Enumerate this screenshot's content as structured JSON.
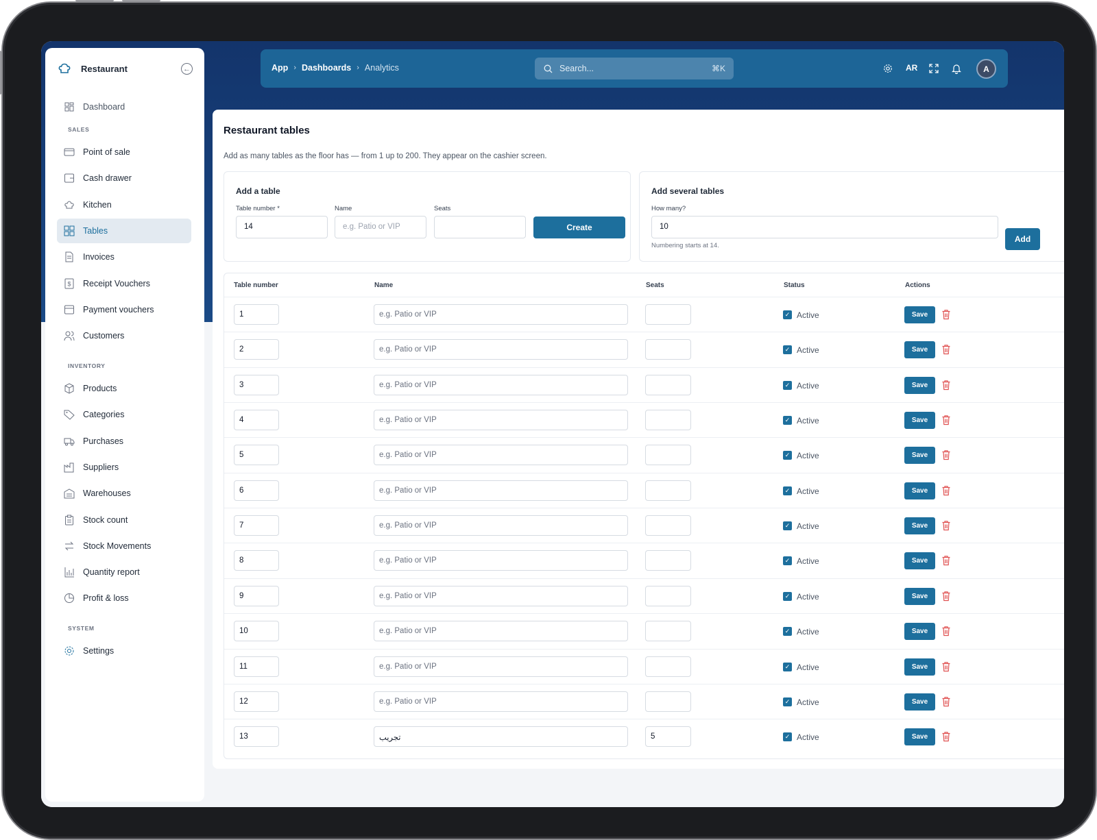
{
  "sidebar": {
    "brand": "Restaurant",
    "dashboard": "Dashboard",
    "sections": {
      "sales": "SALES",
      "inventory": "INVENTORY",
      "system": "SYSTEM"
    },
    "sales_items": [
      "Point of sale",
      "Cash drawer",
      "Kitchen",
      "Tables",
      "Invoices",
      "Receipt Vouchers",
      "Payment vouchers",
      "Customers"
    ],
    "inventory_items": [
      "Products",
      "Categories",
      "Purchases",
      "Suppliers",
      "Warehouses",
      "Stock count",
      "Stock Movements",
      "Quantity report",
      "Profit & loss"
    ],
    "system_items": [
      "Settings"
    ],
    "active_item": "Tables"
  },
  "topbar": {
    "breadcrumb": [
      "App",
      "Dashboards",
      "Analytics"
    ],
    "search_placeholder": "Search...",
    "search_shortcut": "⌘K",
    "lang": "AR",
    "avatar": "A"
  },
  "page": {
    "title": "Restaurant tables",
    "subtitle": "Add as many tables as the floor has — from 1 up to 200. They appear on the cashier screen."
  },
  "add_table": {
    "title": "Add a table",
    "number_label": "Table number *",
    "number_value": "14",
    "name_label": "Name",
    "name_placeholder": "e.g. Patio or VIP",
    "seats_label": "Seats",
    "seats_value": "",
    "create_label": "Create"
  },
  "add_several": {
    "title": "Add several tables",
    "count_label": "How many?",
    "count_value": "10",
    "hint": "Numbering starts at 14.",
    "add_label": "Add"
  },
  "table": {
    "columns": [
      "Table number",
      "Name",
      "Seats",
      "Status",
      "Actions"
    ],
    "name_placeholder": "e.g. Patio or VIP",
    "status_label": "Active",
    "save_label": "Save",
    "rows": [
      {
        "number": "1",
        "name": "",
        "seats": ""
      },
      {
        "number": "2",
        "name": "",
        "seats": ""
      },
      {
        "number": "3",
        "name": "",
        "seats": ""
      },
      {
        "number": "4",
        "name": "",
        "seats": ""
      },
      {
        "number": "5",
        "name": "",
        "seats": ""
      },
      {
        "number": "6",
        "name": "",
        "seats": ""
      },
      {
        "number": "7",
        "name": "",
        "seats": ""
      },
      {
        "number": "8",
        "name": "",
        "seats": ""
      },
      {
        "number": "9",
        "name": "",
        "seats": ""
      },
      {
        "number": "10",
        "name": "",
        "seats": ""
      },
      {
        "number": "11",
        "name": "",
        "seats": ""
      },
      {
        "number": "12",
        "name": "",
        "seats": ""
      },
      {
        "number": "13",
        "name": "تجريب",
        "seats": "5"
      }
    ]
  },
  "colors": {
    "accent": "#1d6f9d",
    "header": "#13346b",
    "danger": "#e05252"
  }
}
